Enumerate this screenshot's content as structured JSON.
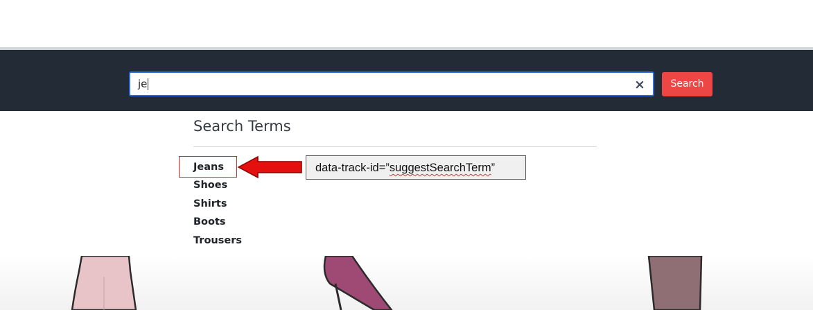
{
  "header": {
    "search": {
      "value": "je",
      "clear_icon": "close-icon"
    },
    "search_button_label": "Search"
  },
  "suggestions": {
    "title": "Search Terms",
    "terms": [
      "Jeans",
      "Shoes",
      "Shirts",
      "Boots",
      "Trousers"
    ]
  },
  "annotation": {
    "callout_prefix": "data-track-id=”",
    "callout_value": "suggestSearchTerm",
    "callout_suffix": "”",
    "arrow_color": "#e02020"
  },
  "colors": {
    "header_bg": "#222b36",
    "accent_button": "#ee4545",
    "focus_border": "#2f6bd6"
  }
}
